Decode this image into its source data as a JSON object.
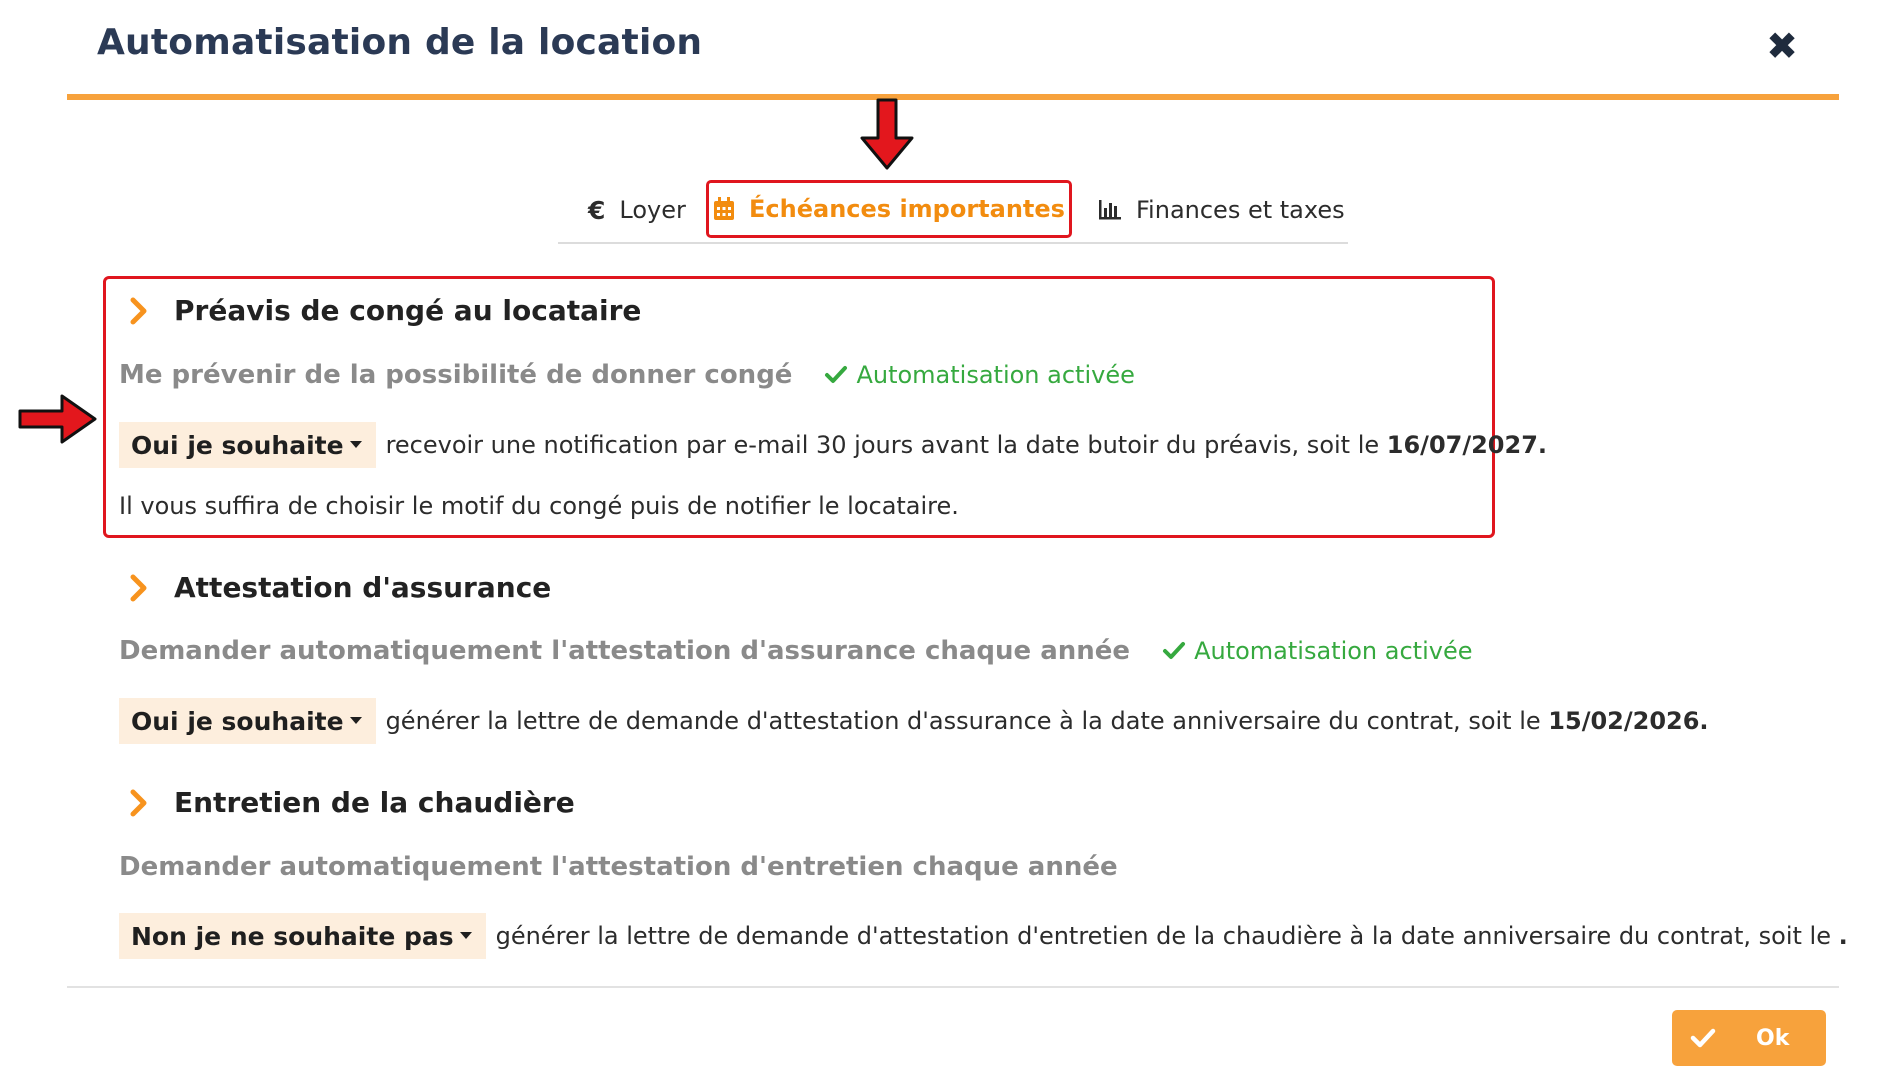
{
  "modal": {
    "title": "Automatisation de la location",
    "close_icon": "close-icon"
  },
  "tabs": [
    {
      "label": "Loyer",
      "icon": "euro-icon"
    },
    {
      "label": "Échéances importantes",
      "icon": "calendar-icon",
      "active": true
    },
    {
      "label": "Finances et taxes",
      "icon": "bar-chart-icon"
    }
  ],
  "sections": [
    {
      "title": "Préavis de congé au locataire",
      "subtitle": "Me prévenir de la possibilité de donner congé",
      "status": "Automatisation activée",
      "dropdown_value": "Oui je souhaite",
      "text": "recevoir une notification par e-mail 30 jours avant la date butoir du préavis, soit le",
      "date": "16/07/2027.",
      "note": "Il vous suffira de choisir le motif du congé puis de notifier le locataire."
    },
    {
      "title": "Attestation d'assurance",
      "subtitle": "Demander automatiquement l'attestation d'assurance chaque année",
      "status": "Automatisation activée",
      "dropdown_value": "Oui je souhaite",
      "text": "générer la lettre de demande d'attestation d'assurance à la date anniversaire du contrat, soit le",
      "date": "15/02/2026."
    },
    {
      "title": "Entretien de la chaudière",
      "subtitle": "Demander automatiquement l'attestation d'entretien chaque année",
      "dropdown_value": "Non je ne souhaite pas",
      "text": "générer la lettre de demande d'attestation d'entretien de la chaudière à la date anniversaire du contrat, soit le",
      "date": "."
    }
  ],
  "footer": {
    "ok_label": "Ok"
  },
  "colors": {
    "accent": "#f7a23c",
    "active_tab_text": "#f28c0f",
    "highlight_border": "#e0161e",
    "status_green": "#36a93f",
    "dropdown_bg": "#fdeedd",
    "title_navy": "#2b3a55"
  }
}
